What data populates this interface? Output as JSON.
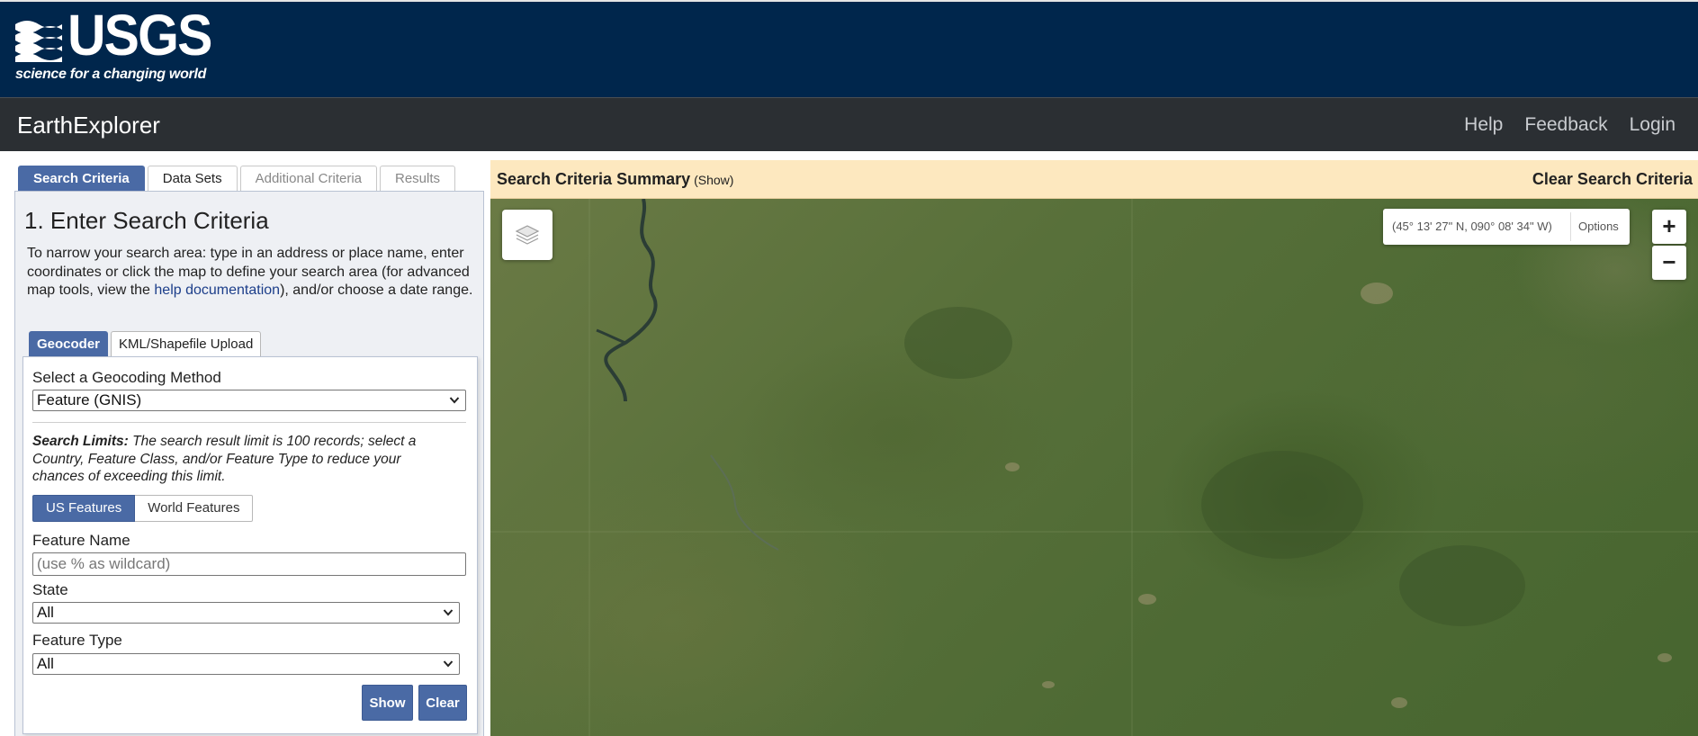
{
  "header": {
    "logo_text": "USGS",
    "tagline": "science for a changing world",
    "app_title": "EarthExplorer",
    "links": [
      "Help",
      "Feedback",
      "Login"
    ]
  },
  "tabs": [
    "Search Criteria",
    "Data Sets",
    "Additional Criteria",
    "Results"
  ],
  "criteria": {
    "title": "1. Enter Search Criteria",
    "desc_before": "To narrow your search area: type in an address or place name, enter coordinates or click the map to define your search area (for advanced map tools, view the ",
    "desc_link": "help documentation",
    "desc_after": "), and/or choose a date range."
  },
  "subtabs": [
    "Geocoder",
    "KML/Shapefile Upload"
  ],
  "geocoder": {
    "method_label": "Select a Geocoding Method",
    "method_value": "Feature (GNIS)",
    "limits_bold": "Search Limits:",
    "limits_text": " The search result limit is 100 records; select a Country, Feature Class, and/or Feature Type to reduce your chances of exceeding this limit.",
    "us_features": "US Features",
    "world_features": "World Features",
    "feature_name_label": "Feature Name",
    "feature_name_placeholder": "(use % as wildcard)",
    "state_label": "State",
    "state_value": "All",
    "feature_type_label": "Feature Type",
    "feature_type_value": "All",
    "show_button": "Show",
    "clear_button": "Clear"
  },
  "summary": {
    "title": "Search Criteria Summary",
    "show_link": "(Show)",
    "clear_link": "Clear Search Criteria"
  },
  "map": {
    "coordinates": "(45° 13' 27\" N, 090° 08' 34\" W)",
    "options_label": "Options",
    "zoom_in": "+",
    "zoom_out": "−"
  },
  "colors": {
    "navy": "#00264c",
    "app_bar": "#2b2f33",
    "accent_blue": "#4a6aa5",
    "summary_bg": "#fde8bf"
  }
}
